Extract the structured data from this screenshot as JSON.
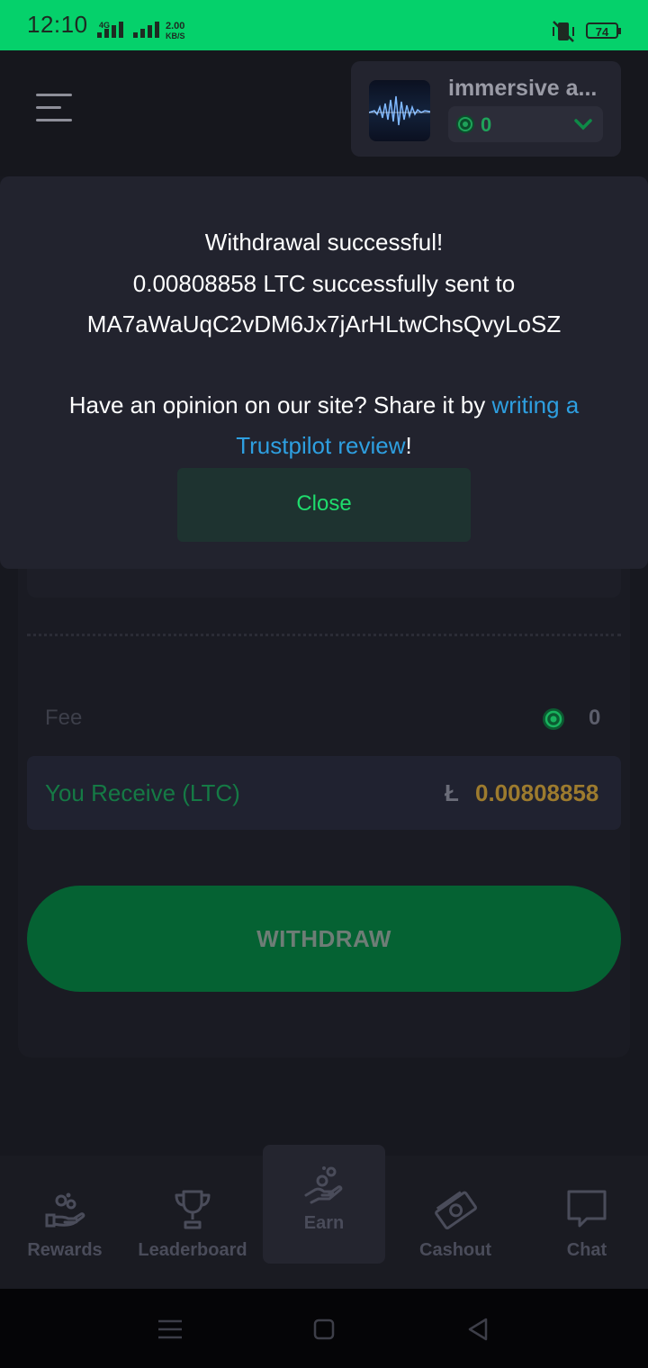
{
  "status_bar": {
    "time": "12:10",
    "network_label": "4G",
    "speed_value": "2.00",
    "speed_unit": "KB/S",
    "battery": "74"
  },
  "header": {
    "account_name": "immersive a...",
    "balance": "0"
  },
  "modal": {
    "line1": "Withdrawal successful!",
    "line2": "0.00808858 LTC successfully sent to",
    "line3": "MA7aWaUqC2vDM6Jx7jArHLtwChsQvyLoSZ",
    "opinion_prefix": "Have an opinion on our site? Share it by ",
    "link_part1": "writing a",
    "link_part2": "Trustpilot review",
    "suffix": "!",
    "close_label": "Close"
  },
  "withdraw": {
    "fee_label": "Fee",
    "fee_value": "0",
    "receive_label": "You Receive (LTC)",
    "receive_symbol": "Ł",
    "receive_amount": "0.00808858",
    "button_label": "WITHDRAW"
  },
  "bottom_nav": {
    "items": [
      {
        "label": "Rewards",
        "icon": "rewards-hand-icon"
      },
      {
        "label": "Leaderboard",
        "icon": "trophy-icon"
      },
      {
        "label": "Earn",
        "icon": "earn-coins-hand-icon"
      },
      {
        "label": "Cashout",
        "icon": "cash-icon"
      },
      {
        "label": "Chat",
        "icon": "chat-bubble-icon"
      }
    ]
  },
  "colors": {
    "status_bar": "#05d16b",
    "accent_green": "#1fdc6d",
    "link_blue": "#2e9fe0",
    "button_green": "#056233",
    "gold": "#9d7b2e"
  }
}
